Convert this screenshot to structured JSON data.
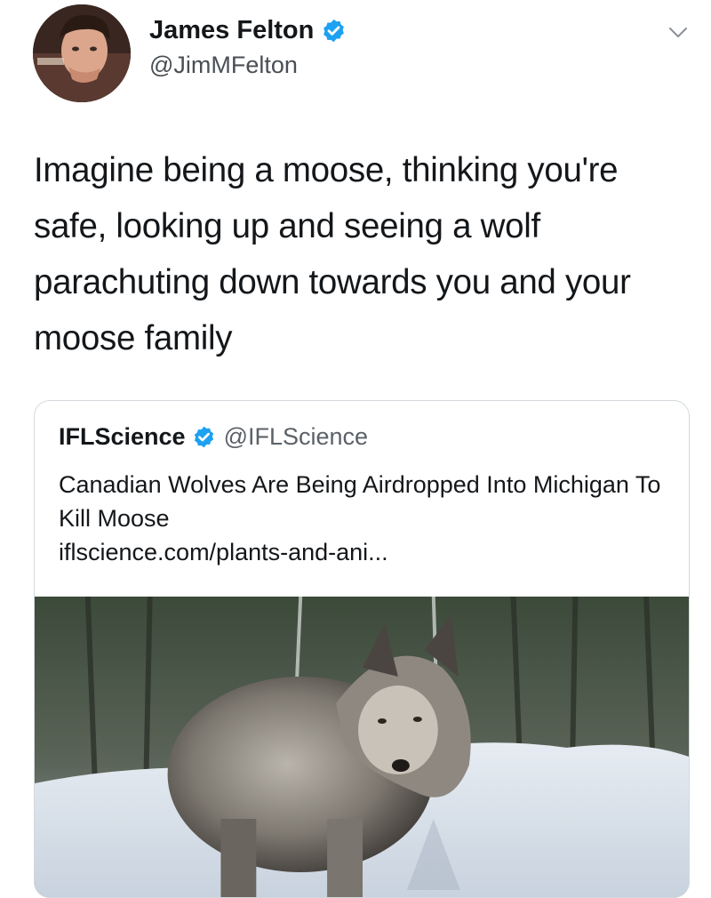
{
  "tweet": {
    "display_name": "James Felton",
    "handle": "@JimMFelton",
    "text": "Imagine being a moose, thinking you're safe, looking up and seeing a wolf parachuting down towards you and your moose family",
    "verified_color": "#1da1f2"
  },
  "quoted": {
    "name": "IFLScience",
    "handle": "@IFLScience",
    "title": "Canadian Wolves Are Being Airdropped Into Michigan To Kill Moose",
    "link": "iflscience.com/plants-and-ani..."
  },
  "icons": {
    "avatar": "profile-photo",
    "verified": "verified-badge-icon",
    "menu": "chevron-down-icon",
    "article_image": "wolf-in-snow-photo"
  }
}
